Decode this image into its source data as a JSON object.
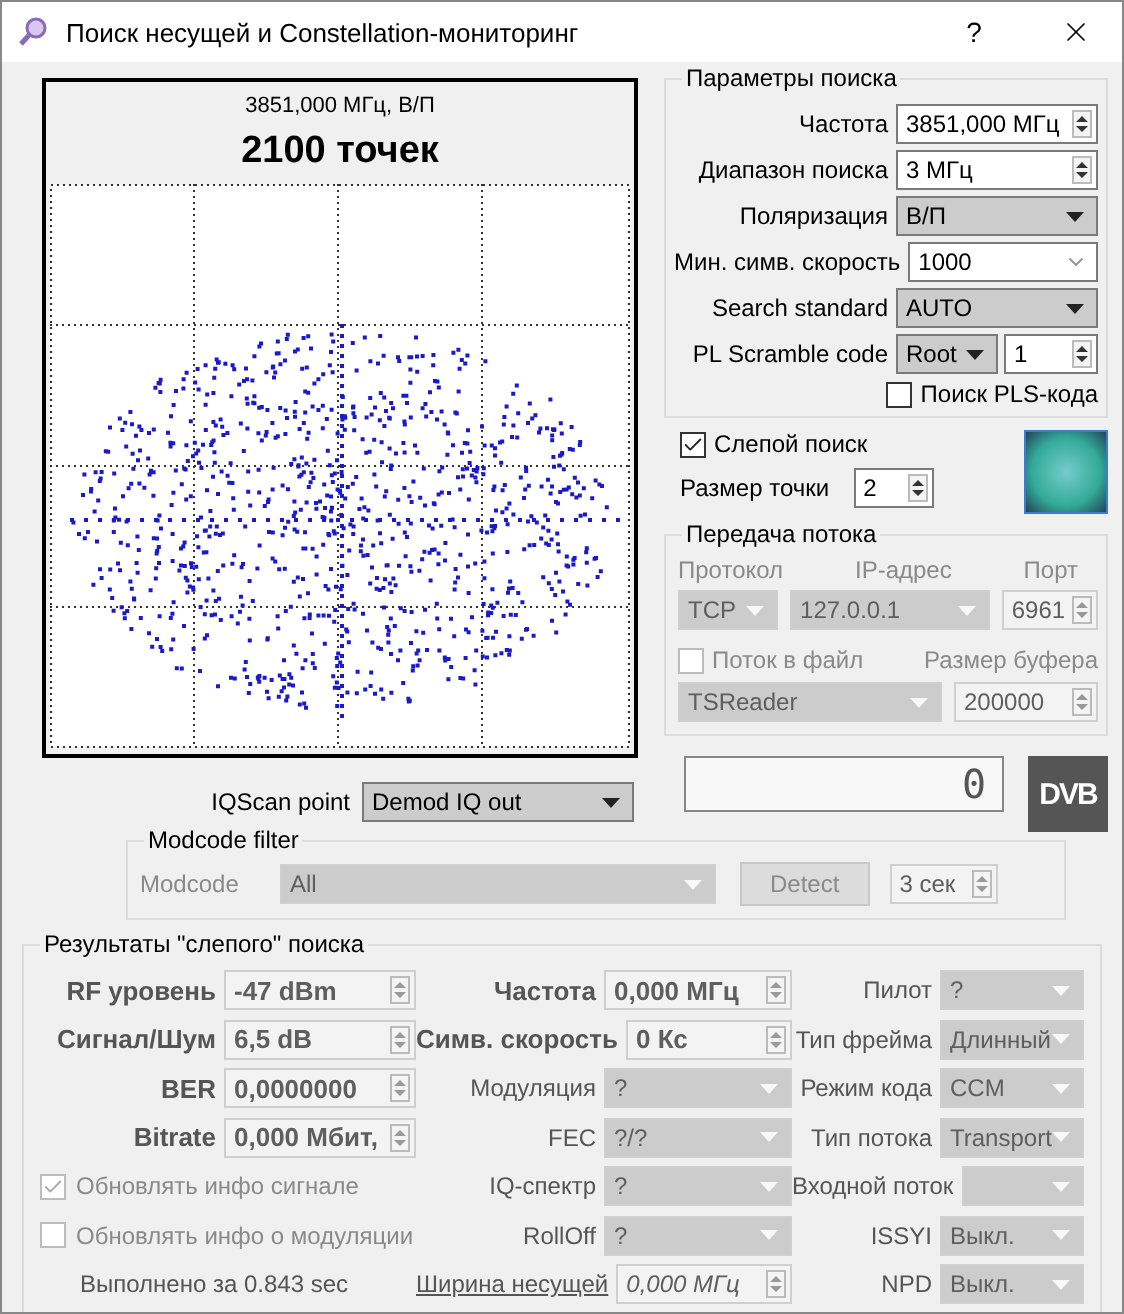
{
  "window": {
    "title": "Поиск несущей и Constellation-мониторинг",
    "help": "?"
  },
  "constellation": {
    "caption": "3851,000 МГц, В/П",
    "points": "2100 точек"
  },
  "iq_scan": {
    "label": "IQScan point",
    "value": "Demod IQ out"
  },
  "search_params": {
    "title": "Параметры поиска",
    "fields": [
      {
        "kind": "spin",
        "label": "Частота",
        "value": "3851,000 МГц"
      },
      {
        "kind": "spin",
        "label": "Диапазон поиска",
        "value": "3 МГц"
      },
      {
        "kind": "select",
        "label": "Поляризация",
        "value": "В/П"
      },
      {
        "kind": "combo",
        "label": "Мин. симв. скорость",
        "value": "1000"
      },
      {
        "kind": "select",
        "label": "Search standard",
        "value": "AUTO"
      },
      {
        "kind": "scramble",
        "label": "PL Scramble code",
        "value": "Root",
        "code": "1"
      }
    ],
    "pls_search": {
      "label": "Поиск PLS-кода",
      "checked": false
    }
  },
  "blind_search": {
    "label": "Слепой поиск",
    "checked": true
  },
  "dot_size": {
    "label": "Размер точки",
    "value": "2"
  },
  "stream": {
    "title": "Передача потока",
    "disabled": true,
    "protocol_label": "Протокол",
    "ip_label": "IP-адрес",
    "port_label": "Порт",
    "protocol": "TCP",
    "ip": "127.0.0.1",
    "port": "6961",
    "to_file": {
      "label": "Поток в файл",
      "checked": false
    },
    "buffer_label": "Размер буфера",
    "reader": "TSReader",
    "buffer": "200000"
  },
  "counter": "0",
  "logo": "DVB",
  "modcode_filter": {
    "title": "Modcode filter",
    "disabled": true,
    "label": "Modcode",
    "value": "All",
    "detect": "Detect",
    "timeout": "3 сек"
  },
  "results": {
    "title": "Результаты \"слепого\" поиска",
    "left": [
      {
        "kind": "spin",
        "label": "RF уровень",
        "value": "-47 dBm"
      },
      {
        "kind": "spin",
        "label": "Сигнал/Шум",
        "value": "6,5 dB"
      },
      {
        "kind": "spin",
        "label": "BER",
        "value": "0,0000000"
      },
      {
        "kind": "spin",
        "label": "Bitrate",
        "value": "0,000 Мбит,"
      },
      {
        "kind": "checkbox",
        "label": "Обновлять инфо сигнале",
        "checked": true
      },
      {
        "kind": "checkbox",
        "label": "Обновлять инфо о модуляции",
        "checked": false
      },
      {
        "kind": "note",
        "label": "Выполнено за 0.843 sec"
      }
    ],
    "middle": [
      {
        "kind": "spin",
        "label": "Частота",
        "value": "0,000 МГц"
      },
      {
        "kind": "spin",
        "label": "Симв. скорость",
        "value": "0 Кс"
      },
      {
        "kind": "select",
        "label": "Модуляция",
        "value": "?"
      },
      {
        "kind": "select",
        "label": "FEC",
        "value": "?/?"
      },
      {
        "kind": "select",
        "label": "IQ-спектр",
        "value": "?"
      },
      {
        "kind": "select",
        "label": "RollOff",
        "value": "?"
      },
      {
        "kind": "link",
        "label": "Ширина несущей",
        "value": "0,000 МГц"
      }
    ],
    "right": [
      {
        "kind": "select",
        "label": "Пилот",
        "value": "?"
      },
      {
        "kind": "select",
        "label": "Тип фрейма",
        "value": "Длинный"
      },
      {
        "kind": "select",
        "label": "Режим кода",
        "value": "CCM"
      },
      {
        "kind": "select",
        "label": "Тип потока",
        "value": "Transport"
      },
      {
        "kind": "select",
        "label": "Входной поток"
      },
      {
        "kind": "select",
        "label": "ISSYI",
        "value": "Выкл."
      },
      {
        "kind": "select",
        "label": "NPD",
        "value": "Выкл."
      }
    ]
  }
}
